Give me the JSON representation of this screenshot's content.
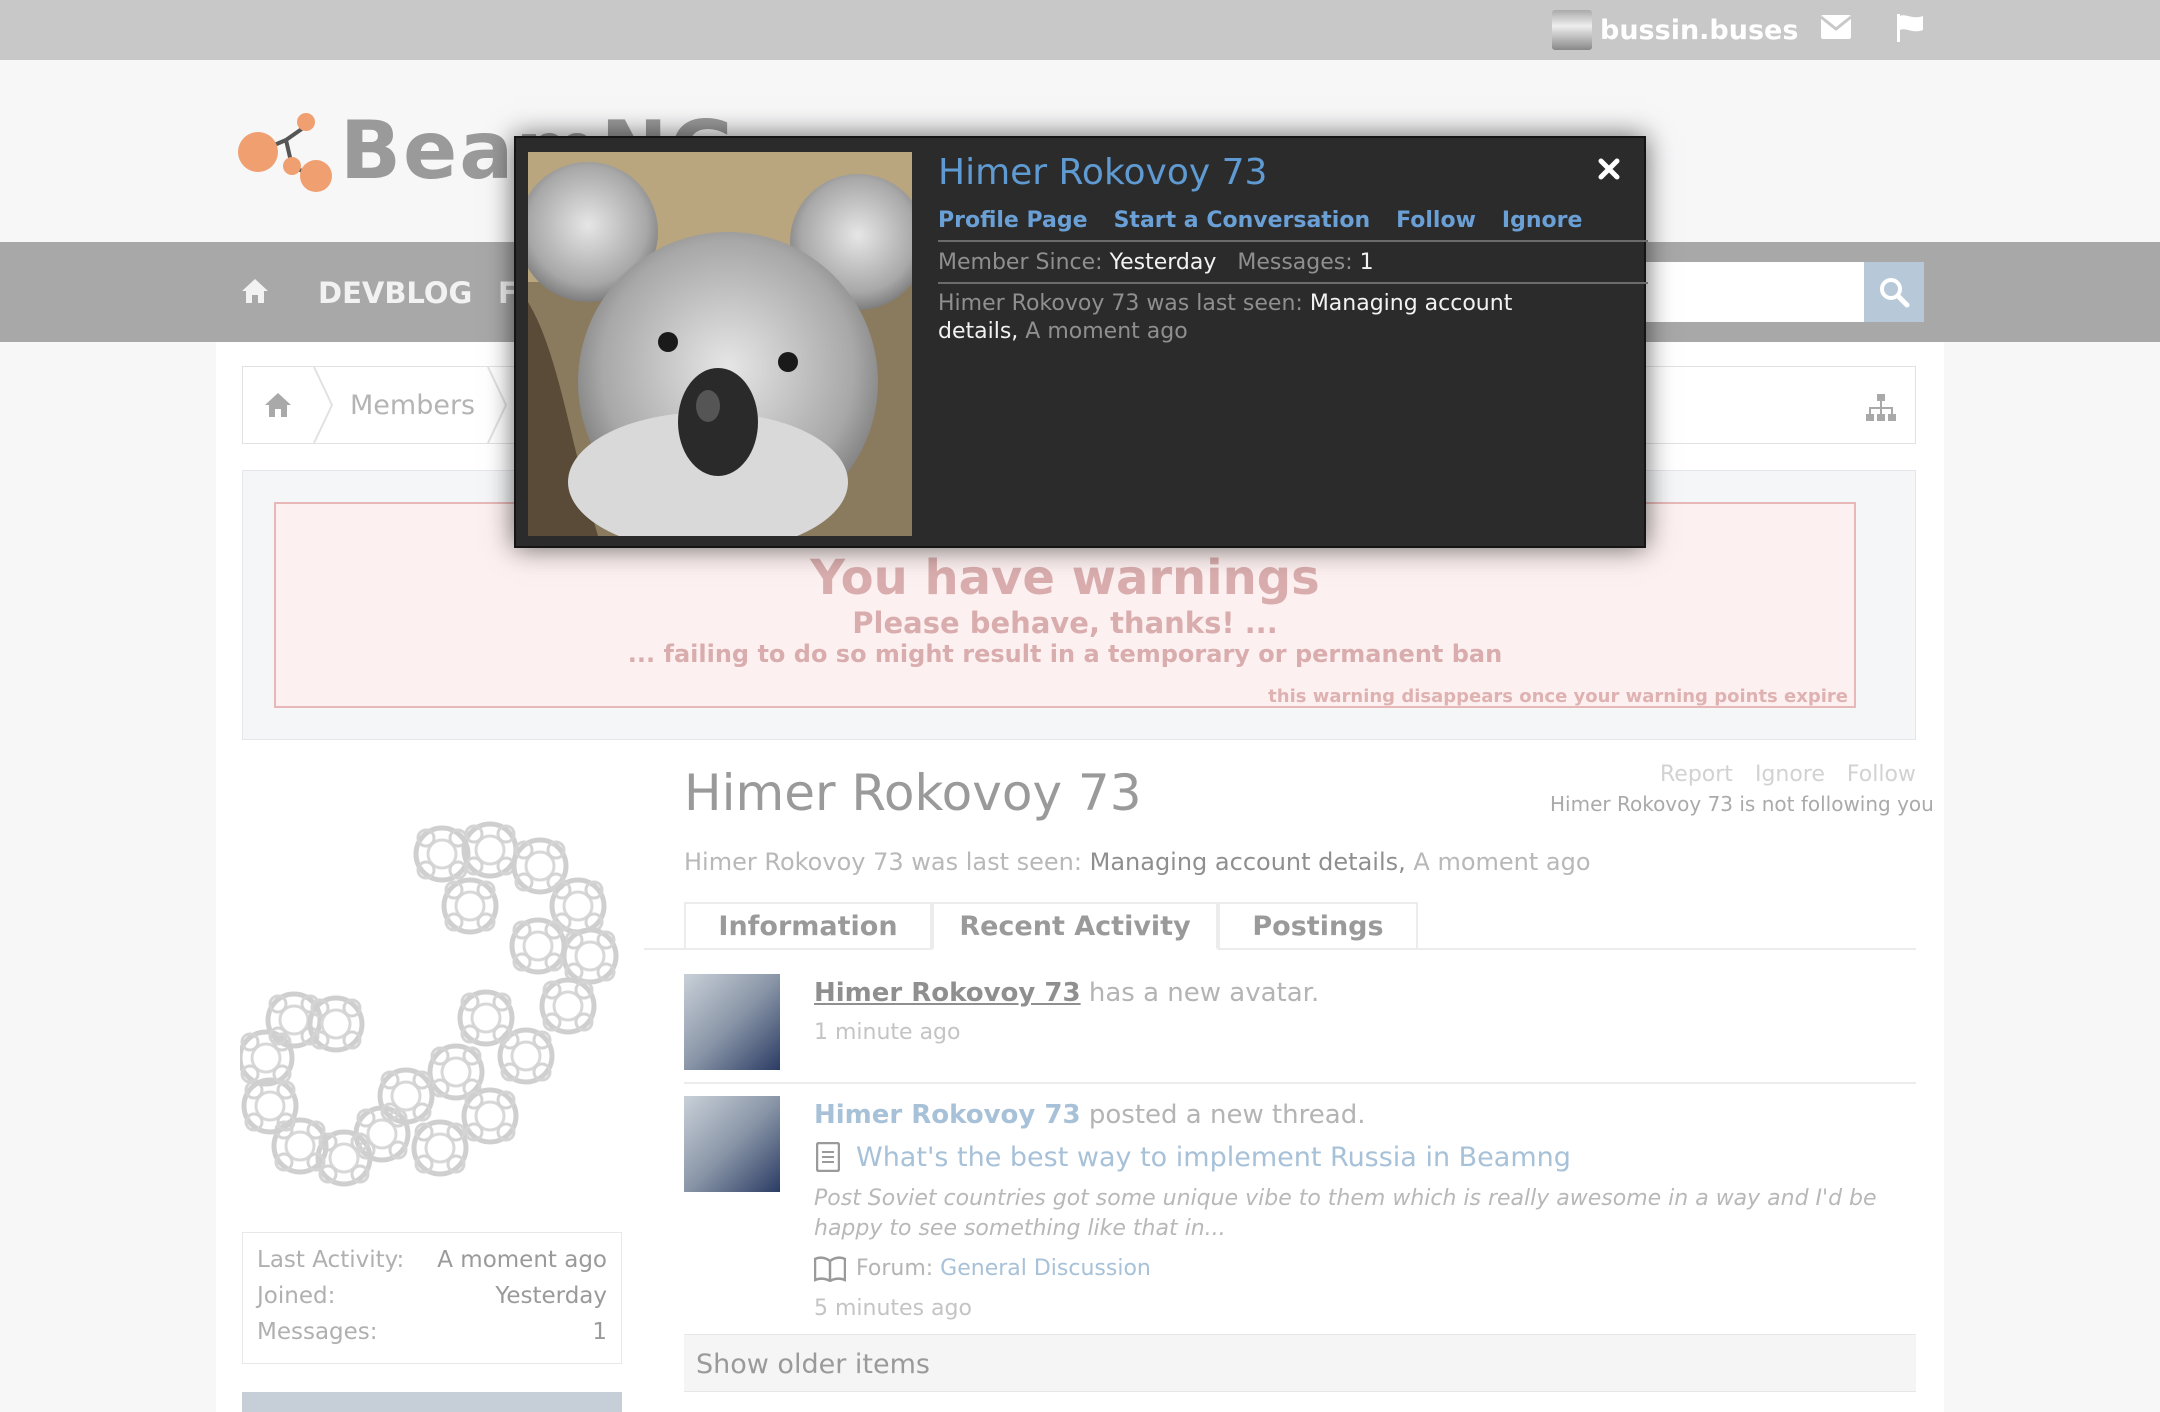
{
  "topbar": {
    "username": "bussin.buses"
  },
  "header": {
    "logo_text": "BeamNG"
  },
  "nav": {
    "devblog": "DEVBLOG",
    "forums_partial": "F"
  },
  "breadcrumb": {
    "members": "Members"
  },
  "warning": {
    "title": "You have warnings",
    "line1": "Please behave, thanks! ...",
    "line2": "... failing to do so might result in a temporary or permanent ban",
    "footer": "this warning disappears once your warning points expire"
  },
  "profile": {
    "name": "Himer Rokovoy 73",
    "report": "Report",
    "ignore": "Ignore",
    "follow": "Follow",
    "not_following": "Himer Rokovoy 73 is not following you",
    "lastseen_prefix": "Himer Rokovoy 73 was last seen:",
    "lastseen_activity": "Managing account details,",
    "lastseen_time": "A moment ago"
  },
  "stats": {
    "last_activity_label": "Last Activity:",
    "last_activity_value": "A moment ago",
    "joined_label": "Joined:",
    "joined_value": "Yesterday",
    "messages_label": "Messages:",
    "messages_value": "1"
  },
  "tabs": {
    "information": "Information",
    "recent": "Recent Activity",
    "postings": "Postings"
  },
  "activity": {
    "a1_user": "Himer Rokovoy 73",
    "a1_action": "has a new avatar.",
    "a1_time": "1 minute ago",
    "a2_user": "Himer Rokovoy 73",
    "a2_action": "posted a new thread.",
    "a2_thread": "What's the best way to implement Russia in Beamng",
    "a2_snippet": "Post Soviet countries got some unique vibe to them which is really awesome in a way and I'd be happy to see something like that in...",
    "a2_forum_label": "Forum:",
    "a2_forum": "General Discussion",
    "a2_time": "5 minutes ago",
    "older": "Show older items"
  },
  "popup": {
    "name": "Himer Rokovoy 73",
    "profile_page": "Profile Page",
    "start_conversation": "Start a Conversation",
    "follow": "Follow",
    "ignore": "Ignore",
    "member_since_label": "Member Since:",
    "member_since_value": "Yesterday",
    "messages_label": "Messages:",
    "messages_value": "1",
    "lastseen_prefix": "Himer Rokovoy 73 was last seen:",
    "lastseen_activity": "Managing account details,",
    "lastseen_time": "A moment ago"
  }
}
